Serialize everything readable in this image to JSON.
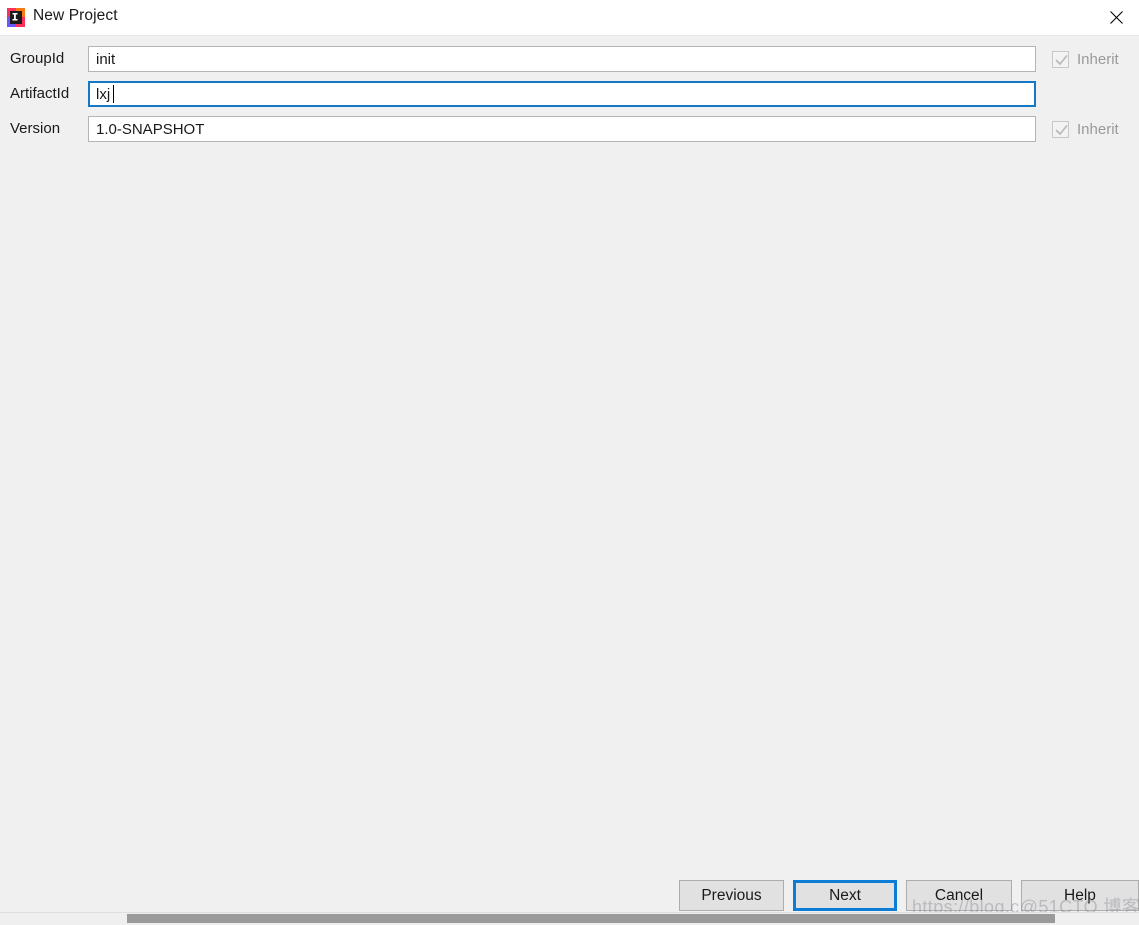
{
  "window": {
    "title": "New Project",
    "app_icon": "intellij-idea-icon",
    "close_icon": "close-icon"
  },
  "form": {
    "rows": [
      {
        "label": "GroupId",
        "value": "init",
        "placeholder": "",
        "focused": false,
        "inherit": {
          "label": "Inherit",
          "checked": true,
          "disabled": true,
          "visible": true
        }
      },
      {
        "label": "ArtifactId",
        "value": "lxj",
        "placeholder": "",
        "focused": true,
        "inherit": {
          "label": "",
          "checked": false,
          "disabled": true,
          "visible": false
        }
      },
      {
        "label": "Version",
        "value": "1.0-SNAPSHOT",
        "placeholder": "",
        "focused": false,
        "inherit": {
          "label": "Inherit",
          "checked": true,
          "disabled": true,
          "visible": true
        }
      }
    ]
  },
  "buttons": [
    {
      "label": "Previous",
      "primary": false
    },
    {
      "label": "Next",
      "primary": true
    },
    {
      "label": "Cancel",
      "primary": false
    },
    {
      "label": "Help",
      "primary": false
    }
  ],
  "watermark": {
    "text": "https://blog.c@51CTO 博客"
  },
  "colors": {
    "dialog_background": "#f0f0f0",
    "titlebar_background": "#ffffff",
    "focus_blue": "#0c7cd5",
    "input_border": "#b4b4b4",
    "button_face": "#e1e1e1",
    "disabled_text": "#9a9a9a"
  }
}
